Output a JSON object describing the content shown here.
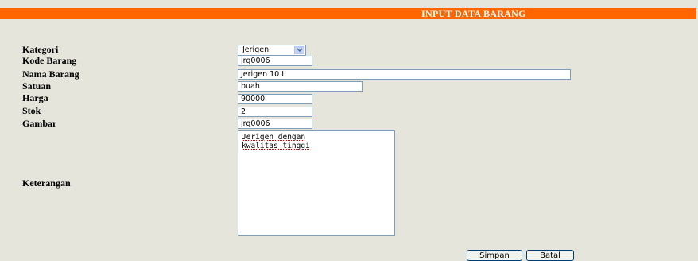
{
  "header": {
    "title": "INPUT DATA BARANG"
  },
  "form": {
    "kategori": {
      "label": "Kategori",
      "value": "Jerigen"
    },
    "kode_barang": {
      "label": "Kode Barang",
      "value": "jrg0006"
    },
    "nama_barang": {
      "label": "Nama Barang",
      "value": "Jerigen 10 L"
    },
    "satuan": {
      "label": "Satuan",
      "value": "buah"
    },
    "harga": {
      "label": "Harga",
      "value": "90000"
    },
    "stok": {
      "label": "Stok",
      "value": "2"
    },
    "gambar": {
      "label": "Gambar",
      "value": "jrg0006"
    },
    "keterangan": {
      "label": "Keterangan",
      "value": "Jerigen dengan\nkwalitas tinggi"
    }
  },
  "buttons": {
    "simpan": "Simpan",
    "batal": "Batal"
  },
  "colors": {
    "header_bg": "#ff6600",
    "page_bg": "#e5e5dc",
    "field_border": "#7f9db9"
  }
}
